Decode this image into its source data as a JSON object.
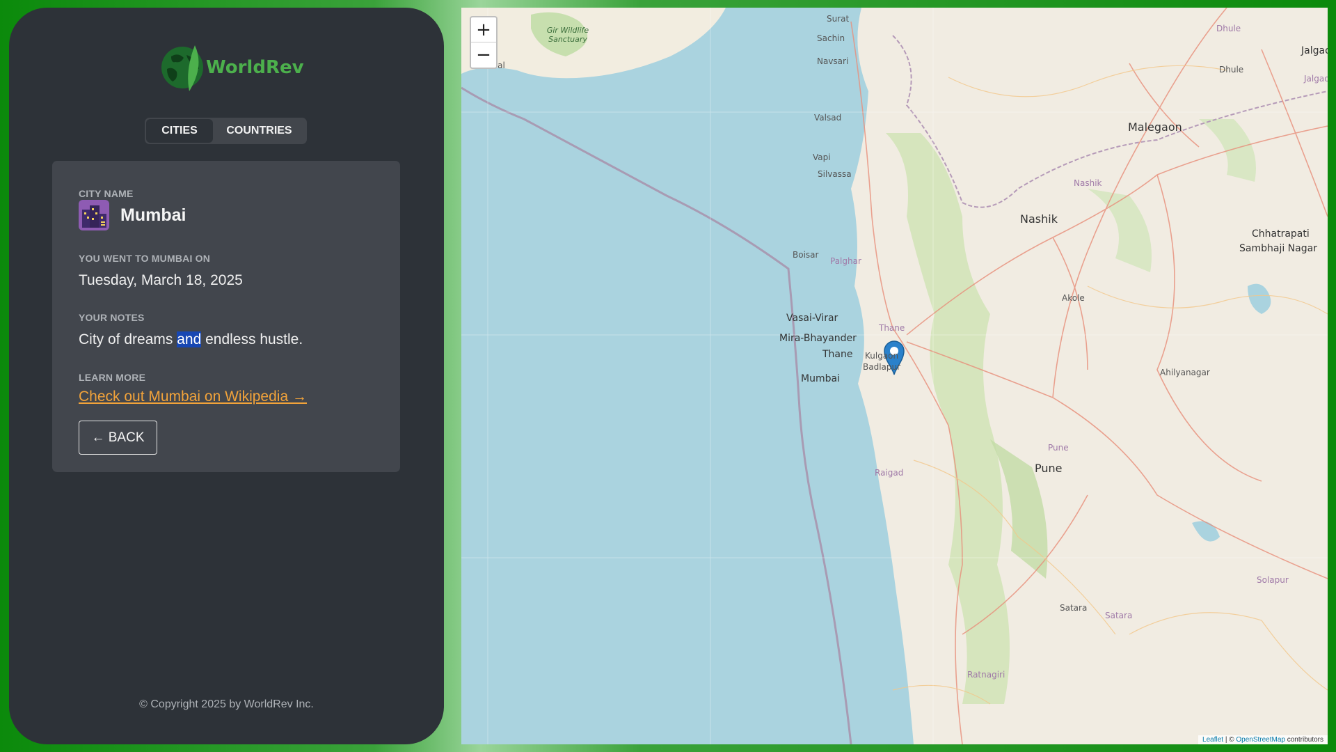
{
  "brand": {
    "name": "WorldRev"
  },
  "tabs": [
    {
      "label": "CITIES",
      "active": true
    },
    {
      "label": "COUNTRIES",
      "active": false
    }
  ],
  "city": {
    "name_label": "CITY NAME",
    "name": "Mumbai",
    "icon": "city-buildings-icon",
    "visited_label": "YOU WENT TO MUMBAI ON",
    "visited_date": "Tuesday, March 18, 2025",
    "notes_label": "YOUR NOTES",
    "notes_before": "City of dreams ",
    "notes_highlight": "and",
    "notes_after": " endless hustle.",
    "learn_label": "LEARN MORE",
    "wiki_link": "Check out Mumbai on Wikipedia →",
    "back_button": "← BACK"
  },
  "footer": {
    "copyright": "© Copyright 2025 by WorldRev Inc."
  },
  "map": {
    "zoom_in": "+",
    "zoom_out": "−",
    "attribution": {
      "leaflet": "Leaflet",
      "sep": " | © ",
      "osm": "OpenStreetMap",
      "contrib": " contributors"
    },
    "marker_icon": "map-pin-icon",
    "places": {
      "surat": "Surat",
      "sachin": "Sachin",
      "navsari": "Navsari",
      "valsad": "Valsad",
      "vapi": "Vapi",
      "silvassa": "Silvassa",
      "boisar": "Boisar",
      "palghar": "Palghar",
      "vasai": "Vasai-Virar",
      "mira": "Mira-Bhayander",
      "thane": "Thane",
      "thane_dist": "Thane",
      "kulgaon": "Kulgaon",
      "badlapur": "Badlapur",
      "mumbai": "Mumbai",
      "nashik": "Nashik",
      "nashik_dist": "Nashik",
      "malegaon": "Malegaon",
      "dhule": "Dhule",
      "dhule_dist": "Dhule",
      "jalgaon": "Jalgaon",
      "jalgaon_dist": "Jalgaon",
      "chhatrapati": "Chhatrapati",
      "sambhaji": "Sambhaji Nagar",
      "akole": "Akole",
      "ahilyanagar": "Ahilyanagar",
      "pune": "Pune",
      "pune_dist": "Pune",
      "raigad": "Raigad",
      "satara": "Satara",
      "satara_dist": "Satara",
      "solapur": "Solapur",
      "ratnagiri": "Ratnagiri",
      "gir": "Gir Wildlife Sanctuary",
      "val": "val"
    }
  },
  "colors": {
    "accent_green": "#4cb04c",
    "link_orange": "#f2a33a",
    "sea": "#aad3df",
    "panel": "#2d3238",
    "card": "#42464d"
  }
}
